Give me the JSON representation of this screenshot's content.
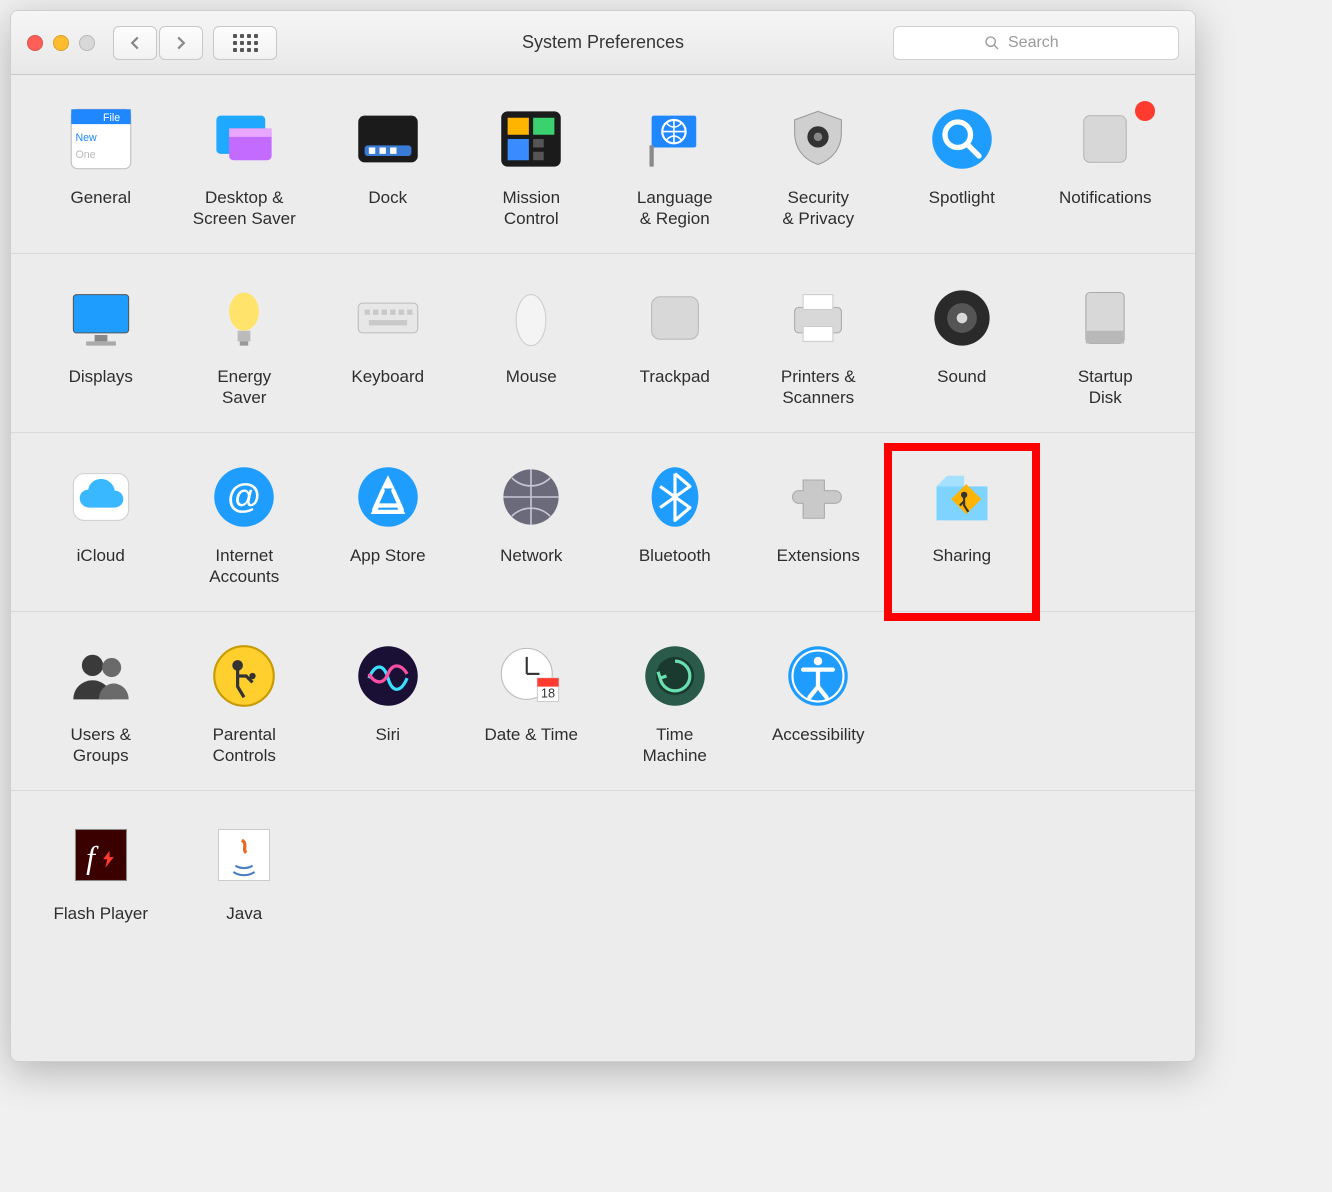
{
  "window": {
    "title": "System Preferences"
  },
  "search": {
    "placeholder": "Search"
  },
  "highlighted": "sharing",
  "rows": [
    {
      "items": [
        {
          "id": "general",
          "label": "General"
        },
        {
          "id": "desktop",
          "label": "Desktop &\nScreen Saver"
        },
        {
          "id": "dock",
          "label": "Dock"
        },
        {
          "id": "mission",
          "label": "Mission\nControl"
        },
        {
          "id": "language",
          "label": "Language\n& Region"
        },
        {
          "id": "security",
          "label": "Security\n& Privacy"
        },
        {
          "id": "spotlight",
          "label": "Spotlight"
        },
        {
          "id": "notifications",
          "label": "Notifications",
          "badge": true
        }
      ]
    },
    {
      "items": [
        {
          "id": "displays",
          "label": "Displays"
        },
        {
          "id": "energy",
          "label": "Energy\nSaver"
        },
        {
          "id": "keyboard",
          "label": "Keyboard"
        },
        {
          "id": "mouse",
          "label": "Mouse"
        },
        {
          "id": "trackpad",
          "label": "Trackpad"
        },
        {
          "id": "printers",
          "label": "Printers &\nScanners"
        },
        {
          "id": "sound",
          "label": "Sound"
        },
        {
          "id": "startup",
          "label": "Startup\nDisk"
        }
      ]
    },
    {
      "items": [
        {
          "id": "icloud",
          "label": "iCloud"
        },
        {
          "id": "internet",
          "label": "Internet\nAccounts"
        },
        {
          "id": "appstore",
          "label": "App Store"
        },
        {
          "id": "network",
          "label": "Network"
        },
        {
          "id": "bluetooth",
          "label": "Bluetooth"
        },
        {
          "id": "extensions",
          "label": "Extensions"
        },
        {
          "id": "sharing",
          "label": "Sharing"
        }
      ]
    },
    {
      "items": [
        {
          "id": "users",
          "label": "Users &\nGroups"
        },
        {
          "id": "parental",
          "label": "Parental\nControls"
        },
        {
          "id": "siri",
          "label": "Siri"
        },
        {
          "id": "datetime",
          "label": "Date & Time"
        },
        {
          "id": "timemachine",
          "label": "Time\nMachine"
        },
        {
          "id": "accessibility",
          "label": "Accessibility"
        }
      ]
    },
    {
      "items": [
        {
          "id": "flash",
          "label": "Flash Player"
        },
        {
          "id": "java",
          "label": "Java"
        }
      ]
    }
  ]
}
